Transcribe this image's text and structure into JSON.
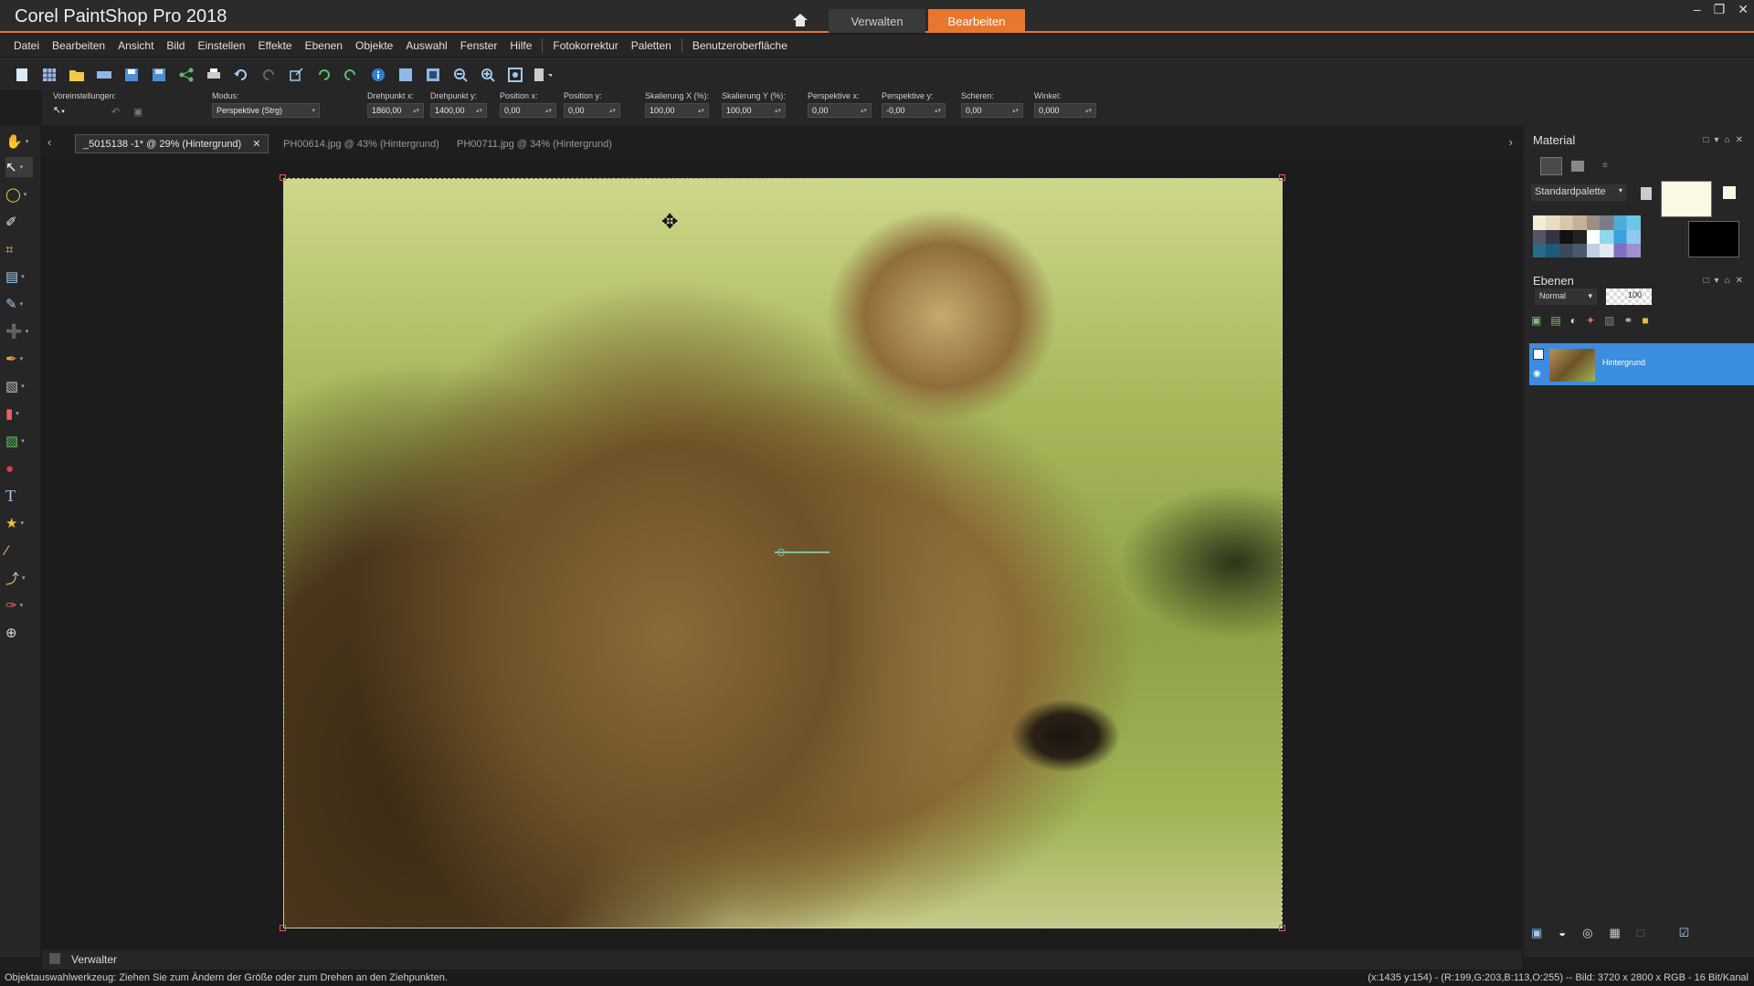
{
  "app": {
    "title": "Corel PaintShop Pro 2018",
    "tabs": {
      "manage": "Verwalten",
      "edit": "Bearbeiten"
    },
    "accent_color": "#e8772e"
  },
  "menu": [
    "Datei",
    "Bearbeiten",
    "Ansicht",
    "Bild",
    "Einstellen",
    "Effekte",
    "Ebenen",
    "Objekte",
    "Auswahl",
    "Fenster",
    "Hilfe",
    "Fotokorrektur",
    "Paletten",
    "Benutzeroberfläche"
  ],
  "options": {
    "presets_label": "Voreinstellungen:",
    "mode_label": "Modus:",
    "mode_value": "Perspektive (Strg)",
    "fields": [
      {
        "label": "Drehpunkt x:",
        "value": "1860,00"
      },
      {
        "label": "Drehpunkt y:",
        "value": "1400,00"
      },
      {
        "label": "Position x:",
        "value": "0,00"
      },
      {
        "label": "Position y:",
        "value": "0,00"
      },
      {
        "label": "Skalierung X (%):",
        "value": "100,00"
      },
      {
        "label": "Skalierung Y (%):",
        "value": "100,00"
      },
      {
        "label": "Perspektive x:",
        "value": "0,00"
      },
      {
        "label": "Perspektive y:",
        "value": "-0,00"
      },
      {
        "label": "Scheren:",
        "value": "0,00"
      },
      {
        "label": "Winkel:",
        "value": "0,000"
      }
    ]
  },
  "doc_tabs": [
    {
      "label": "_5015138 -1* @  29% (Hintergrund)",
      "active": true
    },
    {
      "label": "PH00614.jpg @  43% (Hintergrund)",
      "active": false
    },
    {
      "label": "PH00711.jpg @  34% (Hintergrund)",
      "active": false
    }
  ],
  "panels": {
    "material": {
      "title": "Material",
      "palette_select": "Standardpalette",
      "foreground_color": "#fbf8e3",
      "background_color": "#000000"
    },
    "layers": {
      "title": "Ebenen",
      "blend_mode": "Normal",
      "opacity": "100",
      "layer_name": "Hintergrund",
      "selected_color": "#3b8de0"
    }
  },
  "organizer": {
    "label": "Verwalter"
  },
  "status": {
    "left": "Objektauswahlwerkzeug: Ziehen Sie zum Ändern der Größe oder zum Drehen an den Ziehpunkten.",
    "right": "(x:1435 y:154) - (R:199,G:203,B:113,O:255) -- Bild:  3720 x 2800 x RGB - 16 Bit/Kanal"
  },
  "icons": {
    "home": "home-icon",
    "tools": [
      "pan-icon",
      "pick-tool-icon",
      "lasso-icon",
      "eyedropper-icon",
      "crop-icon",
      "straighten-icon",
      "clone-icon",
      "makeover-icon",
      "paint-brush-icon",
      "gradient-icon",
      "eraser-icon",
      "fill-icon",
      "red-eye-icon",
      "text-icon",
      "preset-shape-icon",
      "pen-icon",
      "warp-brush-icon",
      "color-changer-icon",
      "add-tool-icon"
    ]
  }
}
